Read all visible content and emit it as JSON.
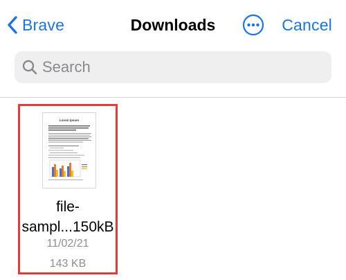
{
  "nav": {
    "back_label": "Brave",
    "title": "Downloads",
    "cancel_label": "Cancel",
    "more_icon": "ellipsis-circle-icon",
    "back_icon": "chevron-left-icon",
    "accent_color": "#1a73e8"
  },
  "search": {
    "placeholder": "Search",
    "value": "",
    "icon": "magnifying-glass-icon"
  },
  "files": [
    {
      "name_line1": "file-",
      "name_line2": "sampl...150kB",
      "date": "11/02/21",
      "size": "143 KB",
      "thumbnail_title": "Lorem ipsum",
      "selected_highlight_color": "#e03c3c"
    }
  ]
}
